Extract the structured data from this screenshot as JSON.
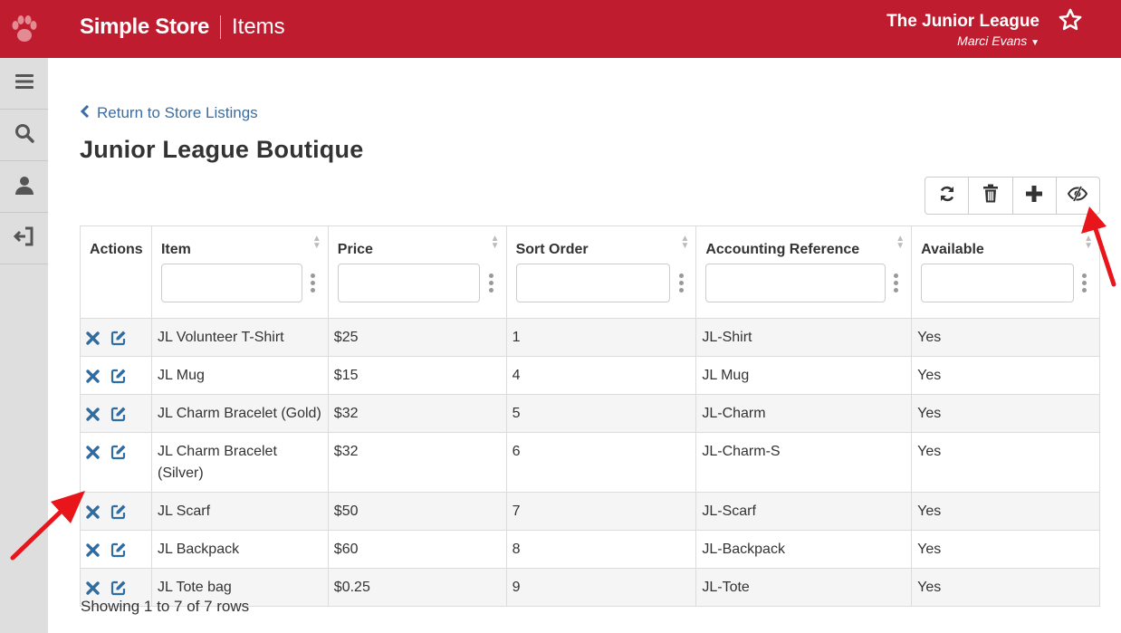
{
  "header": {
    "app_title": "Simple Store",
    "section": "Items",
    "org_name": "The Junior League",
    "user_name": "Marci Evans",
    "brand_color": "#c01c2f"
  },
  "sidebar": {
    "items": [
      {
        "icon": "menu-icon"
      },
      {
        "icon": "search-icon"
      },
      {
        "icon": "user-icon"
      },
      {
        "icon": "sign-out-icon"
      }
    ]
  },
  "main": {
    "back_link": "Return to Store Listings",
    "page_title": "Junior League Boutique"
  },
  "toolbar": {
    "buttons": [
      "refresh-icon",
      "trash-icon",
      "plus-icon",
      "hide-icon"
    ]
  },
  "table": {
    "columns": [
      "Actions",
      "Item",
      "Price",
      "Sort Order",
      "Accounting Reference",
      "Available"
    ],
    "rows": [
      [
        "JL Volunteer T-Shirt",
        "$25",
        "1",
        "JL-Shirt",
        "Yes"
      ],
      [
        "JL Mug",
        "$15",
        "4",
        "JL Mug",
        "Yes"
      ],
      [
        "JL Charm Bracelet (Gold)",
        "$32",
        "5",
        "JL-Charm",
        "Yes"
      ],
      [
        "JL Charm Bracelet (Silver)",
        "$32",
        "6",
        "JL-Charm-S",
        "Yes"
      ],
      [
        "JL Scarf",
        "$50",
        "7",
        "JL-Scarf",
        "Yes"
      ],
      [
        "JL Backpack",
        "$60",
        "8",
        "JL-Backpack",
        "Yes"
      ],
      [
        "JL Tote bag",
        "$0.25",
        "9",
        "JL-Tote",
        "Yes"
      ]
    ]
  },
  "footer": {
    "summary": "Showing 1 to 7 of 7 rows"
  }
}
